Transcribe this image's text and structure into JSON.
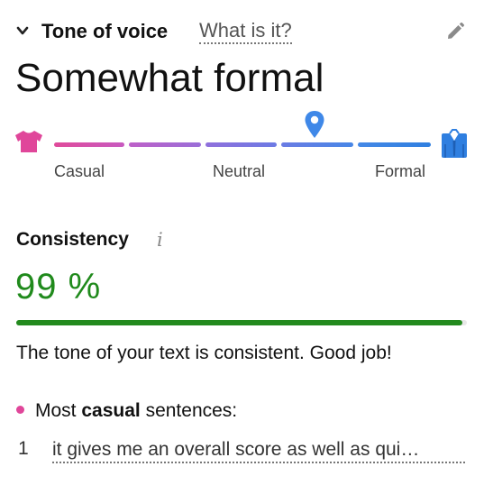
{
  "header": {
    "title": "Tone of voice",
    "what_is_it": "What is it?",
    "icons": {
      "collapse": "chevron-down-icon",
      "edit": "pencil-icon"
    }
  },
  "tone": {
    "value": "Somewhat formal",
    "scale_labels": {
      "casual": "Casual",
      "neutral": "Neutral",
      "formal": "Formal"
    },
    "marker_position": 0.7,
    "icons": {
      "casual": "t-shirt-icon",
      "formal": "suit-icon",
      "marker": "map-pin-icon"
    },
    "colors": {
      "start": "#e0469a",
      "end": "#2f7fe0"
    }
  },
  "consistency": {
    "title": "Consistency",
    "value": "99 %",
    "percent": 99,
    "color": "#238a1e",
    "message": "The tone of your text is consistent. Good job!",
    "info_icon": "info-icon"
  },
  "casual_sentences": {
    "heading_prefix": "Most ",
    "heading_bold": "casual",
    "heading_suffix": " sentences:",
    "bullet_color": "#e0469a",
    "items": [
      {
        "num": "1",
        "text": "it gives me an overall score as well as qui…"
      }
    ]
  }
}
